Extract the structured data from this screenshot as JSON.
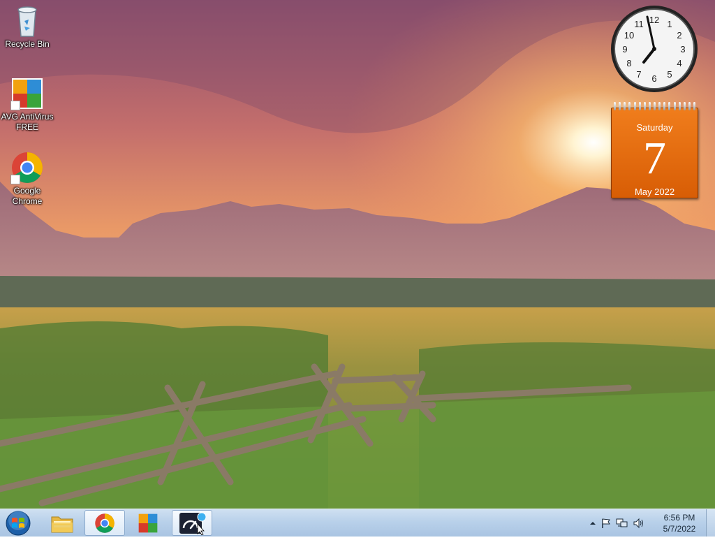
{
  "desktop": {
    "icons": [
      {
        "label": "Recycle Bin",
        "icon": "recycle-bin-icon"
      },
      {
        "label": "AVG AntiVirus FREE",
        "icon": "avg-antivirus-icon"
      },
      {
        "label": "Google Chrome",
        "icon": "chrome-icon"
      }
    ]
  },
  "gadgets": {
    "clock": {
      "time": "6:56"
    },
    "calendar": {
      "day_name": "Saturday",
      "date": "7",
      "month_year": "May 2022"
    }
  },
  "taskbar": {
    "start": {
      "icon": "windows-start-orb-icon"
    },
    "pinned": [
      {
        "name": "File Explorer",
        "icon": "folder-icon"
      },
      {
        "name": "Google Chrome",
        "icon": "chrome-icon",
        "active": true
      },
      {
        "name": "AVG AntiVirus FREE",
        "icon": "avg-antivirus-icon"
      },
      {
        "name": "Speed test",
        "icon": "speedometer-icon",
        "active": true
      }
    ],
    "tray": {
      "icons": [
        "show-hidden-icons-icon",
        "action-center-flag-icon",
        "network-icon",
        "volume-icon"
      ],
      "time": "6:56 PM",
      "date": "5/7/2022"
    }
  },
  "colors": {
    "calendar_orange": "#e8700f",
    "taskbar_blue": "#b9d1ea"
  }
}
